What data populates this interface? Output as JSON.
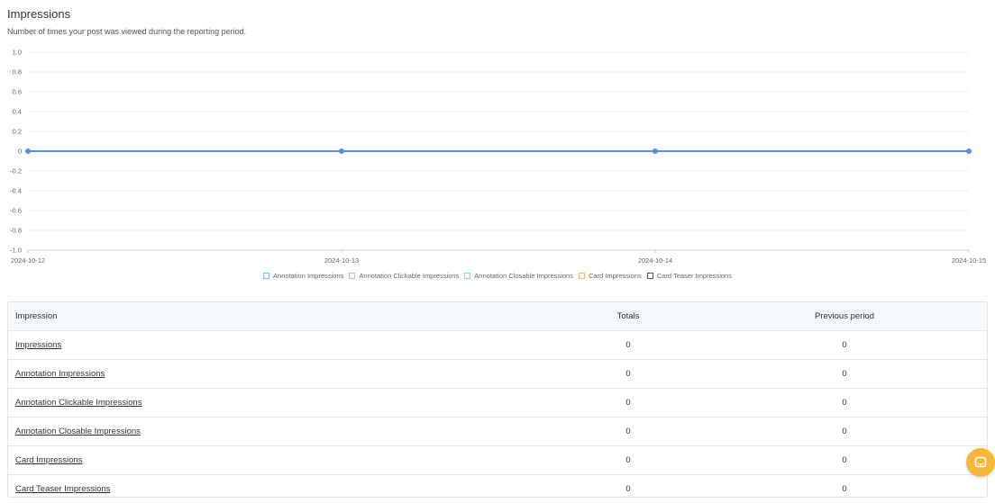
{
  "header": {
    "title": "Impressions",
    "subtitle": "Number of times your post was viewed during the reporting period."
  },
  "colors": {
    "line": "#5b8fd1",
    "grid": "#ececec",
    "axis": "#cfcfcf",
    "chat_button": "#f6b73c"
  },
  "chart_data": {
    "type": "line",
    "x": [
      "2024-10-12",
      "2024-10-13",
      "2024-10-14",
      "2024-10-15"
    ],
    "y_ticks": [
      "1.0",
      "0.8",
      "0.6",
      "0.4",
      "0.2",
      "0",
      "-0.2",
      "-0.4",
      "-0.6",
      "-0.8",
      "-1.0"
    ],
    "ylim": [
      -1.0,
      1.0
    ],
    "grid": true,
    "legend_position": "bottom",
    "series": [
      {
        "values": [
          0,
          0,
          0,
          0
        ],
        "color": "#5b8fd1"
      }
    ],
    "legend": [
      {
        "name": "Annotation Impressions",
        "color": "#7ec3e8"
      },
      {
        "name": "Annotation Clickable Impressions",
        "color": "#f4a7b9"
      },
      {
        "name": "Annotation Closable Impressions",
        "color": "#8fd8d8"
      },
      {
        "name": "Card Impressions",
        "color": "#f7b87a"
      },
      {
        "name": "Card Teaser Impressions",
        "color": "#555555"
      }
    ]
  },
  "table": {
    "headers": [
      "Impression",
      "Totals",
      "Previous period"
    ],
    "rows": [
      {
        "name": "Impressions",
        "totals": "0",
        "previous": "0"
      },
      {
        "name": "Annotation Impressions",
        "totals": "0",
        "previous": "0"
      },
      {
        "name": "Annotation Clickable Impressions",
        "totals": "0",
        "previous": "0"
      },
      {
        "name": "Annotation Closable Impressions",
        "totals": "0",
        "previous": "0"
      },
      {
        "name": "Card Impressions",
        "totals": "0",
        "previous": "0"
      },
      {
        "name": "Card Teaser Impressions",
        "totals": "0",
        "previous": "0"
      }
    ]
  },
  "chat": {
    "icon": "chat-icon"
  }
}
